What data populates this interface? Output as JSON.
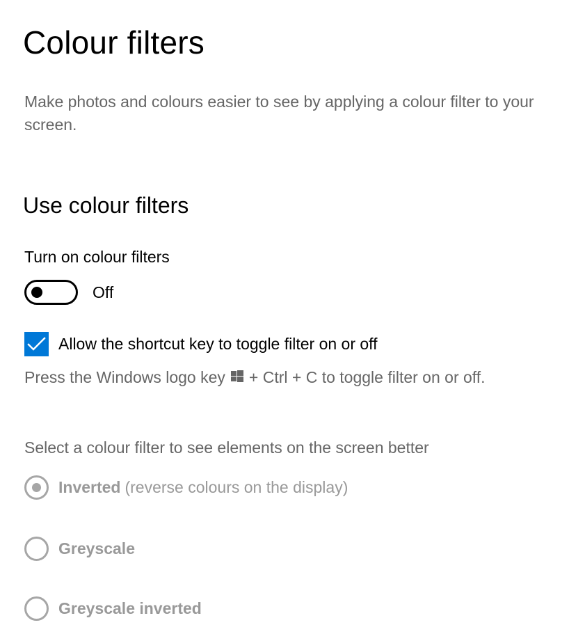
{
  "page": {
    "title": "Colour filters",
    "description": "Make photos and colours easier to see by applying a colour filter to your screen."
  },
  "section": {
    "heading": "Use colour filters"
  },
  "toggle": {
    "label": "Turn on colour filters",
    "state": "Off",
    "is_on": false
  },
  "shortcut": {
    "checkbox_label": "Allow the shortcut key to toggle filter on or off",
    "checked": true,
    "help_prefix": "Press the Windows logo key",
    "help_suffix": "+ Ctrl + C to toggle filter on or off."
  },
  "filters": {
    "prompt": "Select a colour filter to see elements on the screen better",
    "options": [
      {
        "name": "Inverted",
        "description": "(reverse colours on the display)",
        "selected": true,
        "disabled": true
      },
      {
        "name": "Greyscale",
        "description": "",
        "selected": false,
        "disabled": true
      },
      {
        "name": "Greyscale inverted",
        "description": "",
        "selected": false,
        "disabled": true
      }
    ]
  },
  "colors": {
    "accent": "#0078d7",
    "secondary_text": "#666666",
    "disabled": "#999999"
  },
  "icons": {
    "checkmark": "checkmark-icon",
    "windows_logo": "windows-logo-icon"
  }
}
